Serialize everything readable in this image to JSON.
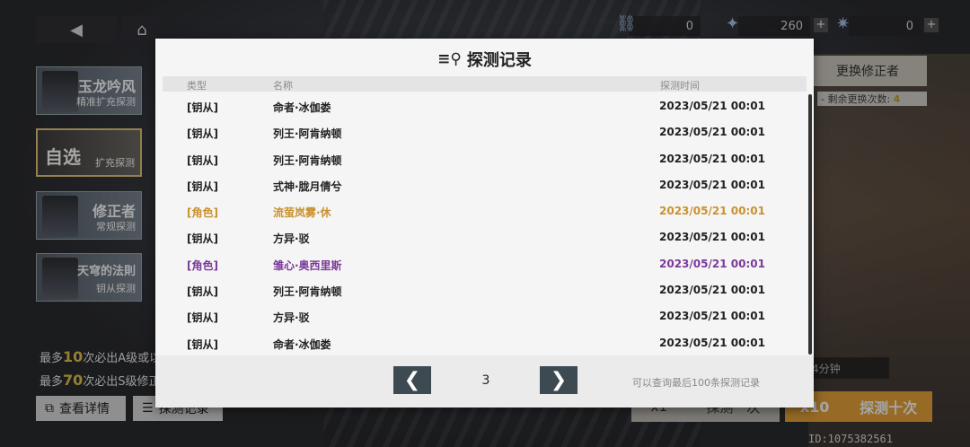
{
  "background": {
    "currencies": [
      {
        "icon": "link-icon",
        "value": "0"
      },
      {
        "icon": "star-crystal-icon",
        "value": "260"
      },
      {
        "icon": "star-gem-icon",
        "value": "0"
      }
    ],
    "banners": [
      {
        "line1": "玉龙吟风",
        "line2": "精准扩充探测"
      },
      {
        "line1": "自选",
        "line2": "扩充探测"
      },
      {
        "line1": "修正者",
        "line2": "常规探测"
      },
      {
        "line1": "天穹的法則",
        "line2": "钥从探测"
      }
    ],
    "info_lines": [
      {
        "prefix": "最多",
        "num": "10",
        "suffix": "次必出A级或以上..."
      },
      {
        "prefix": "最多",
        "num": "70",
        "suffix": "次必出S级修正..."
      }
    ],
    "detail_button": "查看详情",
    "record_button": "探测记录",
    "replace_button": "更换修正者",
    "replace_count_label": "- 剩余更换次数:",
    "replace_count": "4",
    "timer_text": "时14分钟",
    "pull_one": {
      "count": "x1",
      "label": "探测一次"
    },
    "pull_ten": {
      "count": "x10",
      "label": "探测十次"
    },
    "uid": "ID:1075382561"
  },
  "modal": {
    "title": "探测记录",
    "headers": {
      "type": "类型",
      "name": "名称",
      "time": "探测时间"
    },
    "rows": [
      {
        "type": "[钥从]",
        "name": "命者·冰伽娄",
        "time": "2023/05/21 00:01",
        "color": "#222222"
      },
      {
        "type": "[钥从]",
        "name": "列王·阿肯纳顿",
        "time": "2023/05/21 00:01",
        "color": "#222222"
      },
      {
        "type": "[钥从]",
        "name": "列王·阿肯纳顿",
        "time": "2023/05/21 00:01",
        "color": "#222222"
      },
      {
        "type": "[钥从]",
        "name": "式神·胧月倩兮",
        "time": "2023/05/21 00:01",
        "color": "#222222"
      },
      {
        "type": "[角色]",
        "name": "流萤岚雾·休",
        "time": "2023/05/21 00:01",
        "color": "#c8922e"
      },
      {
        "type": "[钥从]",
        "name": "方异·驳",
        "time": "2023/05/21 00:01",
        "color": "#222222"
      },
      {
        "type": "[角色]",
        "name": "雏心·奥西里斯",
        "time": "2023/05/21 00:01",
        "color": "#7a3a9a"
      },
      {
        "type": "[钥从]",
        "name": "列王·阿肯纳顿",
        "time": "2023/05/21 00:01",
        "color": "#222222"
      },
      {
        "type": "[钥从]",
        "name": "方异·驳",
        "time": "2023/05/21 00:01",
        "color": "#222222"
      },
      {
        "type": "[钥从]",
        "name": "命者·冰伽娄",
        "time": "2023/05/21 00:01",
        "color": "#222222"
      }
    ],
    "pager": {
      "prev": "❮",
      "page": "3",
      "next": "❯",
      "note": "可以查询最后100条探测记录"
    }
  }
}
